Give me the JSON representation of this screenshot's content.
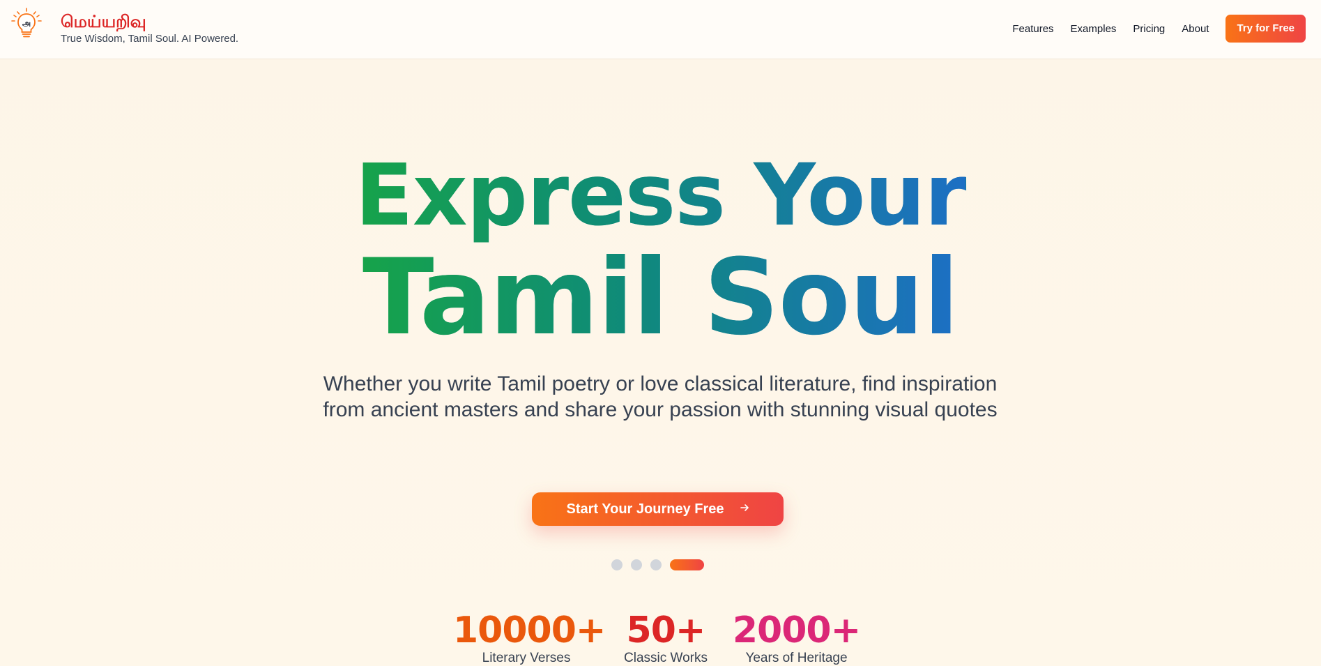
{
  "header": {
    "brand": "மெய்யறிவு",
    "tagline": "True Wisdom, Tamil Soul. AI Powered.",
    "logo_text": "அ",
    "logo_icon": "lightbulb-icon"
  },
  "nav": {
    "items": [
      {
        "label": "Features"
      },
      {
        "label": "Examples"
      },
      {
        "label": "Pricing"
      },
      {
        "label": "About"
      }
    ],
    "cta": "Try for Free"
  },
  "hero": {
    "line1": "Express Your",
    "line2": "Tamil Soul",
    "subtitle": "Whether you write Tamil poetry or love classical literature, find inspiration from ancient masters and share your passion with stunning visual quotes",
    "cta": "Start Your Journey Free",
    "cta_icon": "arrow-right-icon"
  },
  "carousel": {
    "count": 4,
    "active_index": 3
  },
  "stats": [
    {
      "value": "10000+",
      "label": "Literary Verses",
      "color": "#ea580c"
    },
    {
      "value": "50+",
      "label": "Classic Works",
      "color": "#dc2626"
    },
    {
      "value": "2000+",
      "label": "Years of Heritage",
      "color": "#db2777"
    }
  ],
  "colors": {
    "accent_start": "#f97316",
    "accent_end": "#ef4444",
    "hero_green": "#16a34a",
    "hero_blue": "#1d6fc4",
    "background": "#fdf4e6"
  }
}
